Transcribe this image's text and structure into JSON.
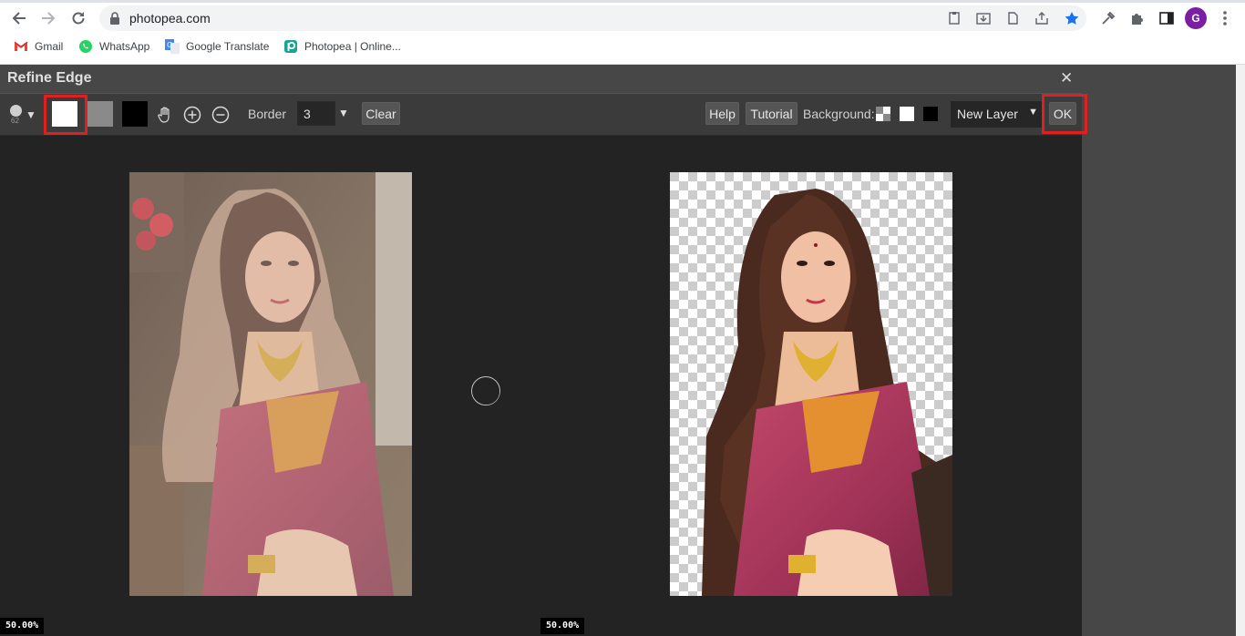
{
  "browser": {
    "url": "photopea.com",
    "avatar_letter": "G",
    "bookmarks": [
      {
        "label": "Gmail"
      },
      {
        "label": "WhatsApp"
      },
      {
        "label": "Google Translate"
      },
      {
        "label": "Photopea | Online..."
      }
    ]
  },
  "dialog": {
    "title": "Refine Edge",
    "close": "✕",
    "toolbar": {
      "brush_size": "62",
      "border_label": "Border",
      "border_value": "3",
      "clear_label": "Clear",
      "help_label": "Help",
      "tutorial_label": "Tutorial",
      "background_label": "Background:",
      "output_select": "New Layer",
      "ok_label": "OK"
    },
    "left_zoom": "50.00%",
    "right_zoom": "50.00%"
  },
  "colors": {
    "accent_highlight": "#e02020",
    "dialog_bg": "#232323",
    "toolbar_bg": "#3b3b3b"
  }
}
